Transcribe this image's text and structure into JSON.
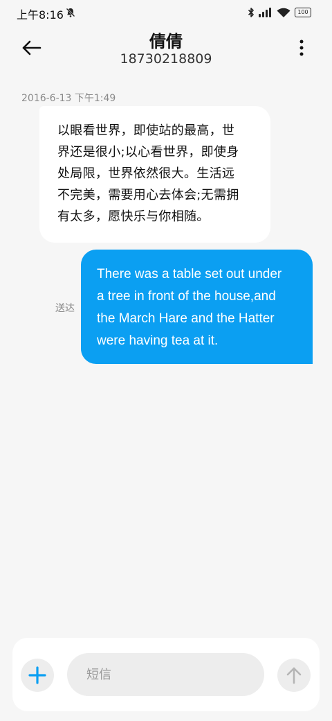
{
  "status_bar": {
    "time": "上午8:16",
    "battery": "100",
    "icons": [
      "do-not-disturb-icon",
      "bluetooth-icon",
      "signal-icon",
      "wifi-icon",
      "battery-icon"
    ]
  },
  "header": {
    "contact_name": "倩倩",
    "phone_number": "18730218809",
    "icons": [
      "back-arrow-icon",
      "more-vertical-icon"
    ]
  },
  "conversation": {
    "timestamp": "2016-6-13 下午1:49",
    "messages": [
      {
        "direction": "incoming",
        "text": "以眼看世界，即使站的最高，世界还是很小;以心看世界，即使身处局限，世界依然很大。生活远不完美，需要用心去体会;无需拥有太多，愿快乐与你相随。",
        "lines": [
          "以眼看世界，即使站的最高，世",
          "界还是很小;以心看世界，即使身",
          "处局限，世界依然很大。生活远",
          "不完美，需要用心去体会;无需拥",
          "有太多，愿快乐与你相随。"
        ]
      },
      {
        "direction": "outgoing",
        "text": "There was a table set out under a tree in front of the house,and the March Hare and the Hatter were having tea at it.",
        "lines": [
          "There was a table set out under",
          "a tree in front of the house,and",
          "the March Hare and the Hatter",
          "were having tea at it."
        ],
        "status": "送达"
      }
    ]
  },
  "composer": {
    "placeholder": "短信",
    "value": "",
    "icons": [
      "plus-icon",
      "send-arrow-icon"
    ]
  },
  "colors": {
    "accent": "#0b9ff2",
    "background": "#f6f6f6",
    "bubble_incoming": "#ffffff"
  }
}
